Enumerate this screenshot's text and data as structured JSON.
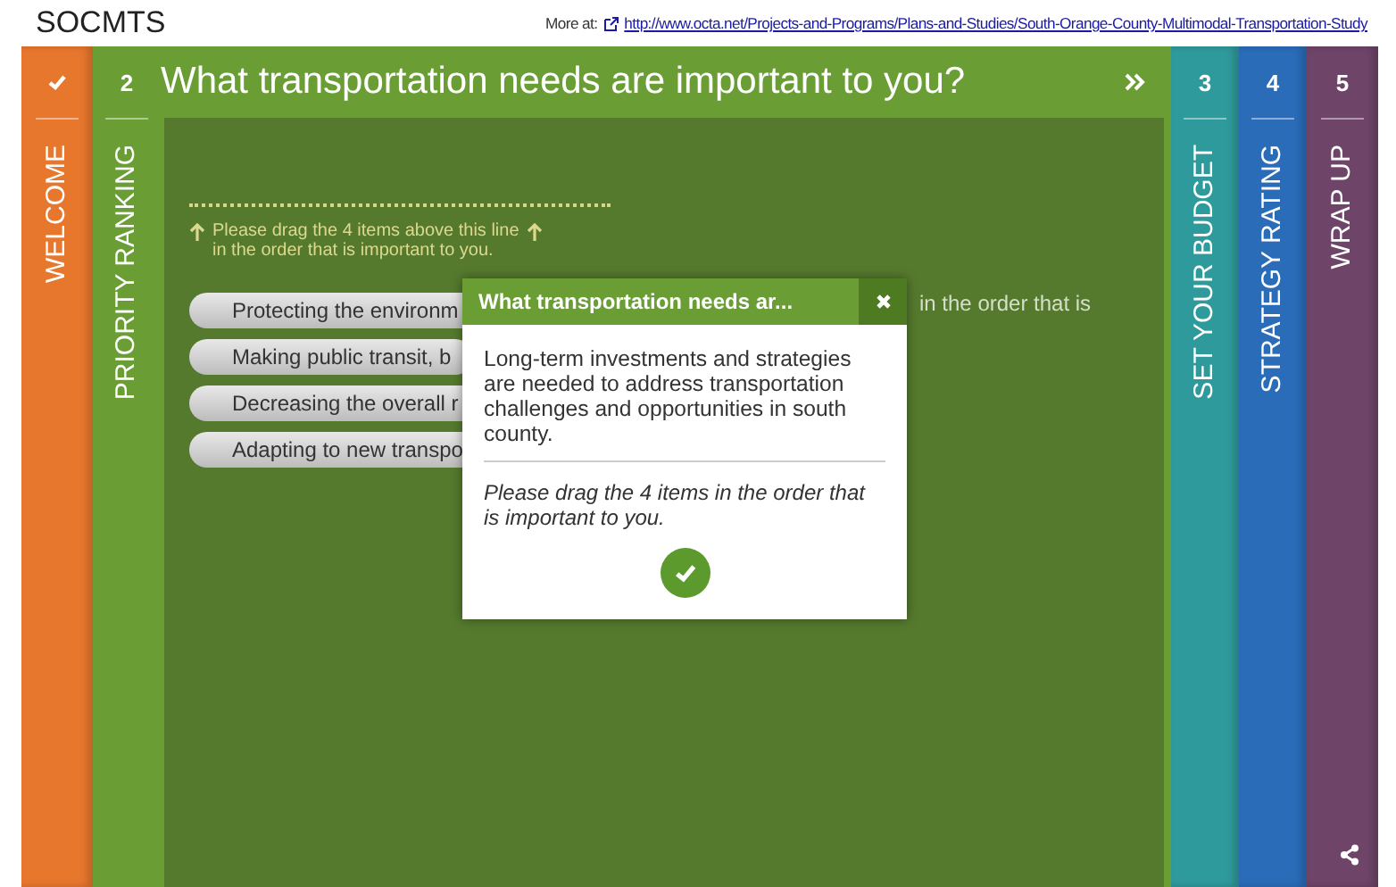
{
  "header": {
    "title": "SOCMTS",
    "more_label": "More at:",
    "link": "http://www.octa.net/Projects-and-Programs/Plans-and-Studies/South-Orange-County-Multimodal-Transportation-Study"
  },
  "steps": [
    {
      "label": "WELCOME",
      "completed": true,
      "selected": false,
      "color": "#e8772e"
    },
    {
      "number": "2",
      "label": "PRIORITY RANKING",
      "completed": false,
      "selected": true,
      "color": "#6a9e35"
    },
    {
      "number": "3",
      "label": "SET YOUR BUDGET",
      "completed": false,
      "selected": false,
      "color": "#2f9a9c"
    },
    {
      "number": "4",
      "label": "STRATEGY RATING",
      "completed": false,
      "selected": false,
      "color": "#2a6cb8"
    },
    {
      "number": "5",
      "label": "WRAP UP",
      "completed": false,
      "selected": false,
      "color": "#6e4468"
    }
  ],
  "question": {
    "title": "What transportation needs are important to you?",
    "instruction_line_1": "Please drag the 4 items above this line",
    "instruction_line_2": "in the order that is important to you.",
    "items": [
      "Protecting the environm",
      "Making public transit, b",
      "Decreasing the overall r",
      "Adapting to new transpo"
    ],
    "hidden_text": "in the order that is"
  },
  "popup": {
    "title": "What transportation needs ar...",
    "body": "Long-term investments and strategies are needed to address transportation challenges and opportunities in south county.",
    "note": "Please drag the 4 items in the order that is important to you."
  }
}
